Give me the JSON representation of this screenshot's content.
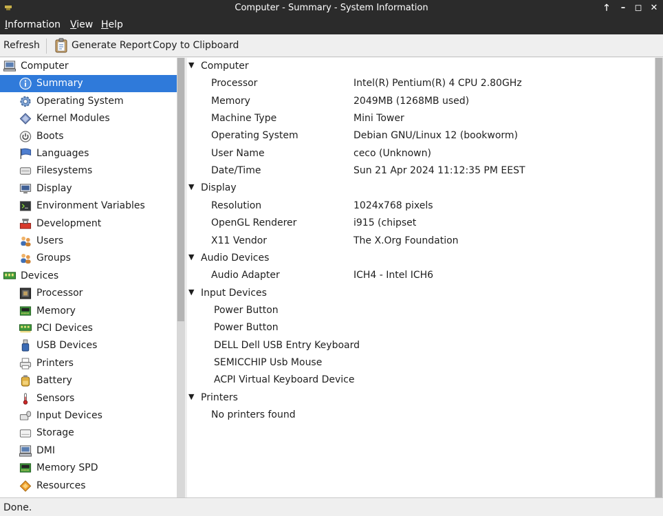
{
  "window": {
    "title": "Computer - Summary - System Information",
    "controls": [
      {
        "name": "maximize-up-button",
        "glyph": "🡑"
      },
      {
        "name": "minimize-button",
        "glyph": "–"
      },
      {
        "name": "restore-button",
        "glyph": "◻"
      },
      {
        "name": "close-button",
        "glyph": "✕"
      }
    ]
  },
  "menubar": {
    "items": [
      {
        "label": "Information",
        "accel": "I",
        "rest": "nformation"
      },
      {
        "label": "View",
        "accel": "V",
        "rest": "iew"
      },
      {
        "label": "Help",
        "accel": "H",
        "rest": "elp"
      }
    ]
  },
  "toolbar": {
    "refresh_label": "Refresh",
    "generate_report_label": "Generate Report",
    "copy_label": "Copy to Clipboard"
  },
  "sidebar": {
    "items": [
      {
        "label": "Computer",
        "icon": "computer-icon",
        "level": 0
      },
      {
        "label": "Summary",
        "icon": "info-icon",
        "level": 1,
        "selected": true
      },
      {
        "label": "Operating System",
        "icon": "gear-icon",
        "level": 1
      },
      {
        "label": "Kernel Modules",
        "icon": "diamond-icon",
        "level": 1
      },
      {
        "label": "Boots",
        "icon": "power-icon",
        "level": 1
      },
      {
        "label": "Languages",
        "icon": "flag-icon",
        "level": 1
      },
      {
        "label": "Filesystems",
        "icon": "drive-icon",
        "level": 1
      },
      {
        "label": "Display",
        "icon": "monitor-icon",
        "level": 1
      },
      {
        "label": "Environment Variables",
        "icon": "terminal-icon",
        "level": 1
      },
      {
        "label": "Development",
        "icon": "toolbox-icon",
        "level": 1
      },
      {
        "label": "Users",
        "icon": "users-icon",
        "level": 1
      },
      {
        "label": "Groups",
        "icon": "groups-icon",
        "level": 1
      },
      {
        "label": "Devices",
        "icon": "board-icon",
        "level": 0
      },
      {
        "label": "Processor",
        "icon": "cpu-icon",
        "level": 1
      },
      {
        "label": "Memory",
        "icon": "memory-icon",
        "level": 1
      },
      {
        "label": "PCI Devices",
        "icon": "pci-icon",
        "level": 1
      },
      {
        "label": "USB Devices",
        "icon": "usb-icon",
        "level": 1
      },
      {
        "label": "Printers",
        "icon": "printer-icon",
        "level": 1
      },
      {
        "label": "Battery",
        "icon": "battery-icon",
        "level": 1
      },
      {
        "label": "Sensors",
        "icon": "thermometer-icon",
        "level": 1
      },
      {
        "label": "Input Devices",
        "icon": "keyboard-mouse-icon",
        "level": 1
      },
      {
        "label": "Storage",
        "icon": "storage-icon",
        "level": 1
      },
      {
        "label": "DMI",
        "icon": "dmi-icon",
        "level": 1
      },
      {
        "label": "Memory SPD",
        "icon": "spd-icon",
        "level": 1
      },
      {
        "label": "Resources",
        "icon": "resources-icon",
        "level": 1
      }
    ]
  },
  "content": {
    "rows": [
      {
        "type": "section",
        "label": "Computer"
      },
      {
        "type": "kv",
        "key": "Processor",
        "value": "Intel(R) Pentium(R) 4 CPU 2.80GHz"
      },
      {
        "type": "kv",
        "key": "Memory",
        "value": "2049MB (1268MB used)"
      },
      {
        "type": "kv",
        "key": "Machine Type",
        "value": "Mini Tower"
      },
      {
        "type": "kv",
        "key": "Operating System",
        "value": "Debian GNU/Linux 12 (bookworm)"
      },
      {
        "type": "kv",
        "key": "User Name",
        "value": "ceco (Unknown)"
      },
      {
        "type": "kv",
        "key": "Date/Time",
        "value": "Sun 21 Apr 2024 11:12:35 PM EEST"
      },
      {
        "type": "section",
        "label": "Display"
      },
      {
        "type": "kv",
        "key": "Resolution",
        "value": "1024x768 pixels"
      },
      {
        "type": "kv",
        "key": "OpenGL Renderer",
        "value": "i915 (chipset"
      },
      {
        "type": "kv",
        "key": "X11 Vendor",
        "value": "The X.Org Foundation"
      },
      {
        "type": "section",
        "label": "Audio Devices"
      },
      {
        "type": "kv",
        "key": "Audio Adapter",
        "value": "ICH4 - Intel ICH6"
      },
      {
        "type": "section",
        "label": "Input Devices"
      },
      {
        "type": "item",
        "key": "Power Button"
      },
      {
        "type": "item",
        "key": "Power Button"
      },
      {
        "type": "item",
        "key": "DELL Dell USB Entry Keyboard"
      },
      {
        "type": "item",
        "key": "SEMICCHIP Usb Mouse"
      },
      {
        "type": "item",
        "key": "ACPI Virtual Keyboard Device"
      },
      {
        "type": "section",
        "label": "Printers"
      },
      {
        "type": "kv",
        "key": "No printers found",
        "value": ""
      }
    ]
  },
  "status": {
    "text": "Done."
  },
  "colors": {
    "selection": "#2f7ada",
    "titlebar": "#2b2b2b"
  }
}
